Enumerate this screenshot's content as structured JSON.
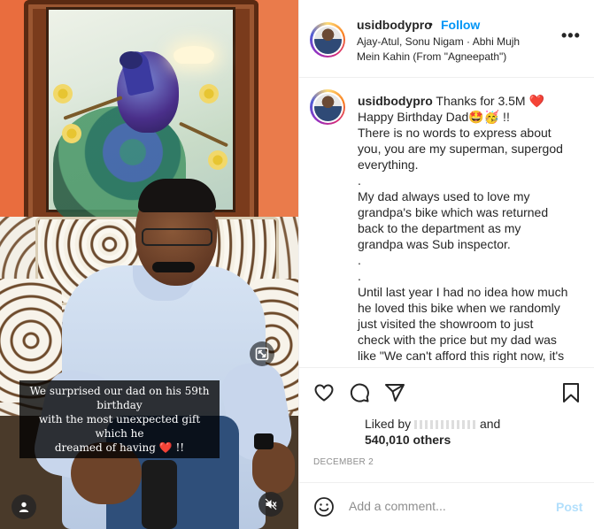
{
  "post": {
    "video": {
      "caption_line1": "We surprised our dad on his 59th birthday",
      "caption_line2": "with the most unexpected gift which he",
      "caption_line3": "dreamed of having",
      "caption_heart": "❤️",
      "caption_tail": " !!",
      "icons": [
        "crop-icon",
        "user-icon",
        "mute-icon"
      ]
    },
    "header": {
      "username": "usidbodypro",
      "separator": "•",
      "follow_label": "Follow",
      "audio": "Ajay-Atul, Sonu Nigam · Abhi Mujh Mein Kahin (From \"Agneepath\")",
      "more_label": "•••"
    },
    "caption": {
      "username": "usidbodypro",
      "line1_text": "Thanks for 3.5M",
      "line1_emoji": "❤️",
      "line2_text": "Happy Birthday Dad",
      "line2_emoji": "🤩🥳",
      "line2_tail": " !!",
      "lines": [
        "There is no words to express about",
        "you, you are my superman, supergod",
        "everything.",
        ".",
        "My dad always used to love my",
        "grandpa's bike which was returned",
        "back to the department as my",
        "grandpa was Sub inspector.",
        ".",
        ".",
        "Until last year I had no idea how much",
        "he loved this bike when we randomly",
        "just visited the showroom to just",
        "check with the price but my dad was",
        "like \"We can't afford this right now, it's"
      ]
    },
    "likes": {
      "prefix": "Liked by",
      "suffix": "and",
      "count_text": "540,010 others"
    },
    "date": "DECEMBER 2",
    "add_comment": {
      "placeholder": "Add a comment...",
      "post_label": "Post"
    },
    "colors": {
      "follow": "#0095f6",
      "post_disabled": "#b2dffc",
      "muted_text": "#8e8e8e",
      "heart": "#ed1c24"
    }
  }
}
